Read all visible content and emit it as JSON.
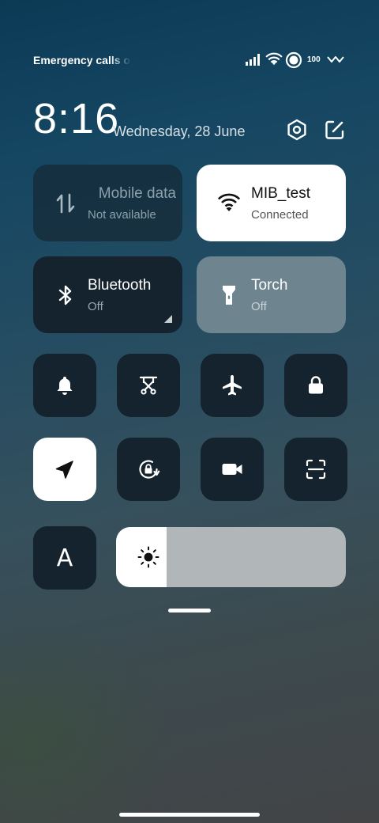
{
  "status_bar": {
    "carrier_text": "Emergency calls only",
    "battery_level": "100",
    "icons": [
      "signal-icon",
      "wifi-icon",
      "do-not-disturb-icon",
      "data-activity-icon"
    ]
  },
  "header": {
    "time": "8:16",
    "date": "Wednesday, 28 June",
    "icons": [
      "settings-icon",
      "edit-icon"
    ]
  },
  "tiles": {
    "mobile_data": {
      "title": "Mobile data",
      "status": "Not available"
    },
    "wifi": {
      "title": "MIB_test",
      "status": "Connected"
    },
    "bluetooth": {
      "title": "Bluetooth",
      "status": "Off"
    },
    "torch": {
      "title": "Torch",
      "status": "Off"
    }
  },
  "quick_toggles": [
    {
      "icon": "bell-icon",
      "active": false
    },
    {
      "icon": "screenshot-icon",
      "active": false
    },
    {
      "icon": "airplane-icon",
      "active": false
    },
    {
      "icon": "lock-icon",
      "active": false
    },
    {
      "icon": "location-icon",
      "active": true
    },
    {
      "icon": "rotation-lock-icon",
      "active": false
    },
    {
      "icon": "video-camera-icon",
      "active": false
    },
    {
      "icon": "scanner-icon",
      "active": false
    },
    {
      "icon": "font-size-icon",
      "label": "A",
      "active": false
    }
  ],
  "brightness": {
    "level": 0.22,
    "icon": "sun-icon"
  },
  "colors": {
    "tile_dark": "#14232d",
    "tile_active": "#ffffff",
    "tile_torch": "#6e8590",
    "slider_track": "#b1b6b9"
  }
}
